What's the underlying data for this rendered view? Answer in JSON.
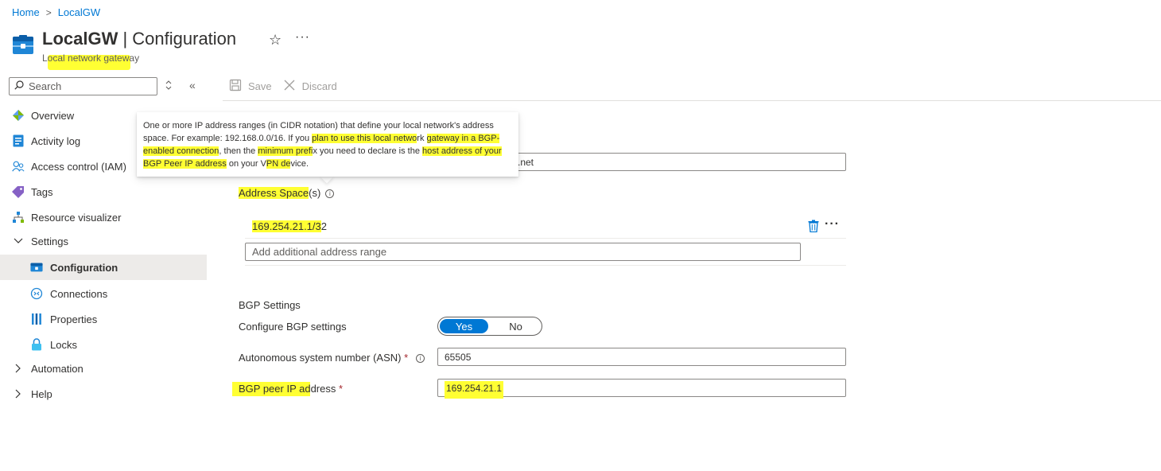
{
  "breadcrumb": {
    "home": "Home",
    "current": "LocalGW",
    "separator": ">"
  },
  "header": {
    "name": "LocalGW",
    "section": " | Configuration",
    "subtitle": "Local network gateway",
    "favorite_icon": "star-icon",
    "more_icon": "ellipsis-icon"
  },
  "search": {
    "placeholder": "Search"
  },
  "toolbar": {
    "save_label": "Save",
    "discard_label": "Discard"
  },
  "sidebar": {
    "items": [
      {
        "label": "Overview",
        "icon": "overview-icon"
      },
      {
        "label": "Activity log",
        "icon": "activity-log-icon"
      },
      {
        "label": "Access control (IAM)",
        "icon": "iam-icon"
      },
      {
        "label": "Tags",
        "icon": "tag-icon"
      },
      {
        "label": "Resource visualizer",
        "icon": "visualizer-icon"
      },
      {
        "label": "Settings",
        "icon": "chevron-down-icon"
      },
      {
        "label": "Configuration",
        "icon": "configuration-icon"
      },
      {
        "label": "Connections",
        "icon": "connections-icon"
      },
      {
        "label": "Properties",
        "icon": "properties-icon"
      },
      {
        "label": "Locks",
        "icon": "lock-icon"
      },
      {
        "label": "Automation",
        "icon": "chevron-right-icon"
      },
      {
        "label": "Help",
        "icon": "chevron-right-icon"
      }
    ]
  },
  "tooltip": {
    "p1": "One or more IP address ranges (in CIDR notation) that define your local network's address space. For example: 192.168.0.0/16. If you ",
    "h1": "plan to use this local netwo",
    "p2": "rk ",
    "h2": "gateway in a BGP-enabled connection",
    "p3": ", then the ",
    "h3": "minimum prefi",
    "p4": "x you need to declare is the ",
    "h4": "host address of your BGP Peer IP address",
    "p5": " on your V",
    "h5": "PN de",
    "p6": "vice."
  },
  "fqdn_field": {
    "value_suffix": ".net"
  },
  "address_space": {
    "label_hl": "Address Space",
    "label_rest": "(s)",
    "entry_hl": "169.254.21.1/3",
    "entry_rest": "2",
    "add_placeholder": "Add additional address range"
  },
  "bgp": {
    "section_title": "BGP Settings",
    "configure_label": "Configure BGP settings",
    "yes": "Yes",
    "no": "No",
    "asn_label": "Autonomous system number (ASN)",
    "asn_value": "65505",
    "peer_label": "BGP peer IP address",
    "peer_value": "169.254.21.1",
    "required_mark": "*"
  },
  "colors": {
    "accent": "#0078d4",
    "highlight": "#ffff33",
    "required": "#a4262c"
  }
}
